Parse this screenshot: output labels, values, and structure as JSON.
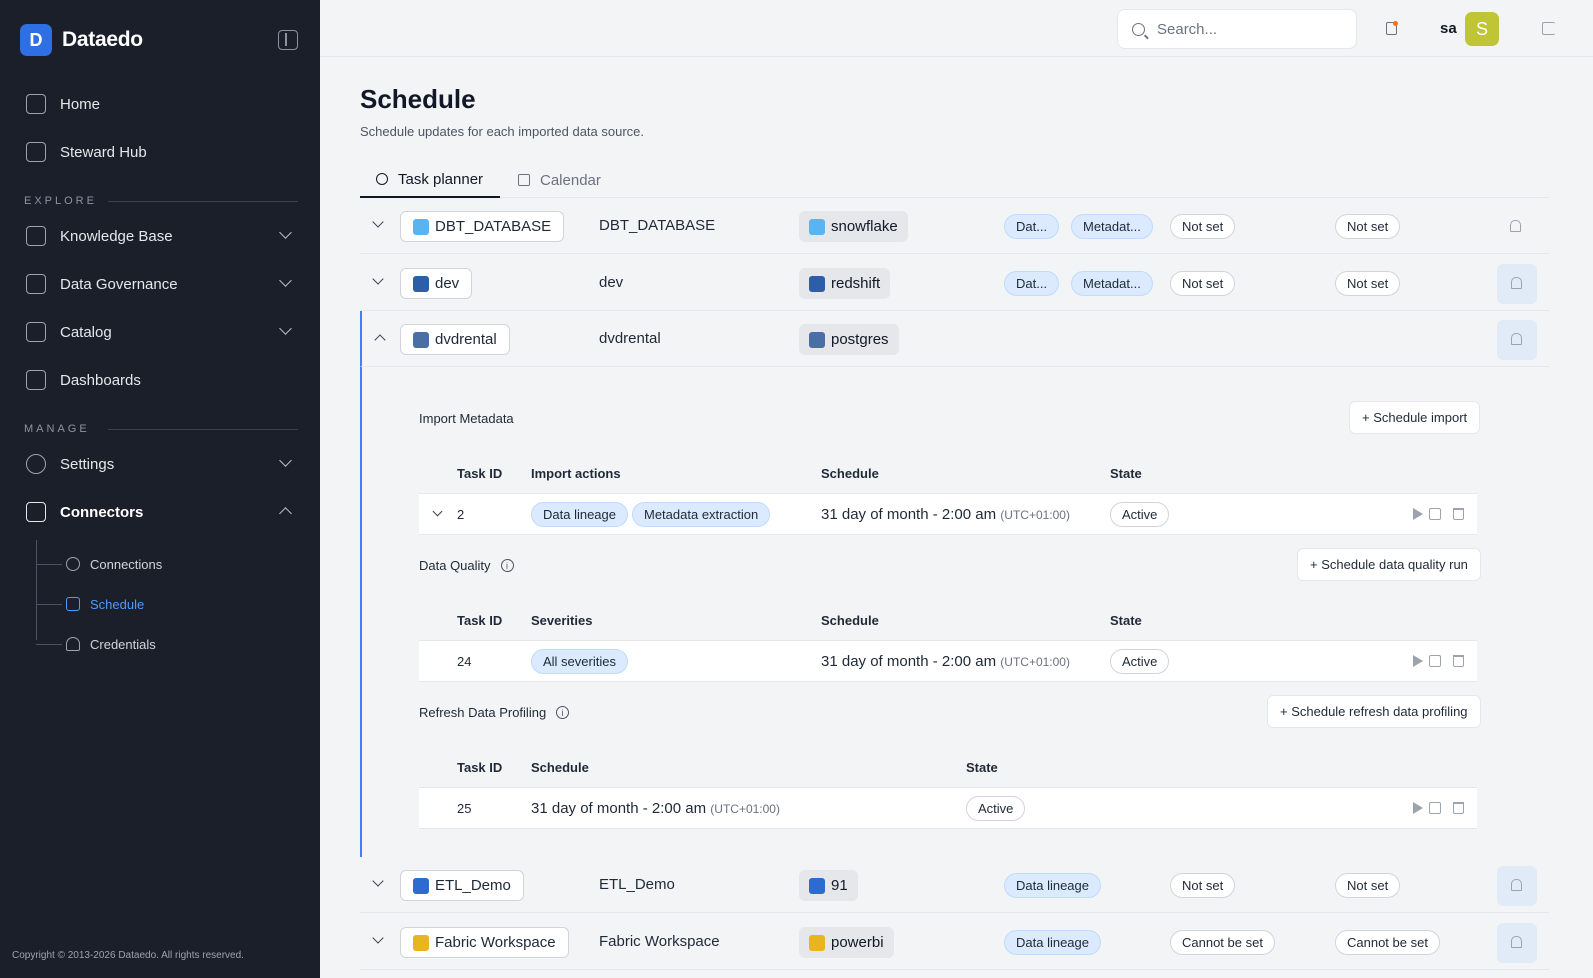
{
  "brand": {
    "name": "Dataedo",
    "mark": "D"
  },
  "sidebar": {
    "home": "Home",
    "steward_hub": "Steward Hub",
    "explore_label": "EXPLORE",
    "knowledge_base": "Knowledge Base",
    "data_governance": "Data Governance",
    "catalog": "Catalog",
    "dashboards": "Dashboards",
    "manage_label": "MANAGE",
    "settings": "Settings",
    "connectors": "Connectors",
    "sub": {
      "connections": "Connections",
      "schedule": "Schedule",
      "credentials": "Credentials"
    },
    "copyright": "Copyright © 2013-2026 Dataedo. All rights reserved."
  },
  "header": {
    "search_placeholder": "Search...",
    "user_initials": "sa",
    "avatar_letter": "S",
    "avatar_color": "#c0c533",
    "notification_color": "#f97316"
  },
  "page": {
    "title": "Schedule",
    "subtitle": "Schedule updates for each imported data source.",
    "tabs": {
      "task_planner": "Task planner",
      "calendar": "Calendar"
    }
  },
  "sources": {
    "dbt": {
      "name": "DBT_DATABASE",
      "col": "DBT_DATABASE",
      "type": "snowflake",
      "p1": "Dat...",
      "p2": "Metadat...",
      "s1": "Not set",
      "s2": "Not set"
    },
    "dev": {
      "name": "dev",
      "col": "dev",
      "type": "redshift",
      "p1": "Dat...",
      "p2": "Metadat...",
      "s1": "Not set",
      "s2": "Not set"
    },
    "dvd": {
      "name": "dvdrental",
      "col": "dvdrental",
      "type": "postgres"
    },
    "etl": {
      "name": "ETL_Demo",
      "col": "ETL_Demo",
      "type": "91",
      "p1": "Data lineage",
      "s1": "Not set",
      "s2": "Not set"
    },
    "fabric": {
      "name": "Fabric Workspace",
      "col": "Fabric Workspace",
      "type": "powerbi",
      "p1": "Data lineage",
      "s1": "Cannot be set",
      "s2": "Cannot be set"
    }
  },
  "expanded": {
    "import": {
      "title": "Import Metadata",
      "button": "+ Schedule import",
      "headers": {
        "task_id": "Task ID",
        "actions": "Import actions",
        "schedule": "Schedule",
        "state": "State"
      },
      "row": {
        "task_id": "2",
        "a1": "Data lineage",
        "a2": "Metadata extraction",
        "schedule": "31 day of month - 2:00 am",
        "tz": "(UTC+01:00)",
        "state": "Active"
      }
    },
    "quality": {
      "title": "Data Quality",
      "button": "+ Schedule data quality run",
      "headers": {
        "task_id": "Task ID",
        "severities": "Severities",
        "schedule": "Schedule",
        "state": "State"
      },
      "row": {
        "task_id": "24",
        "severity": "All severities",
        "schedule": "31 day of month - 2:00 am",
        "tz": "(UTC+01:00)",
        "state": "Active"
      }
    },
    "profiling": {
      "title": "Refresh Data Profiling",
      "button": "+ Schedule refresh data profiling",
      "headers": {
        "task_id": "Task ID",
        "schedule": "Schedule",
        "state": "State"
      },
      "row": {
        "task_id": "25",
        "schedule": "31 day of month - 2:00 am",
        "tz": "(UTC+01:00)",
        "state": "Active"
      }
    }
  }
}
